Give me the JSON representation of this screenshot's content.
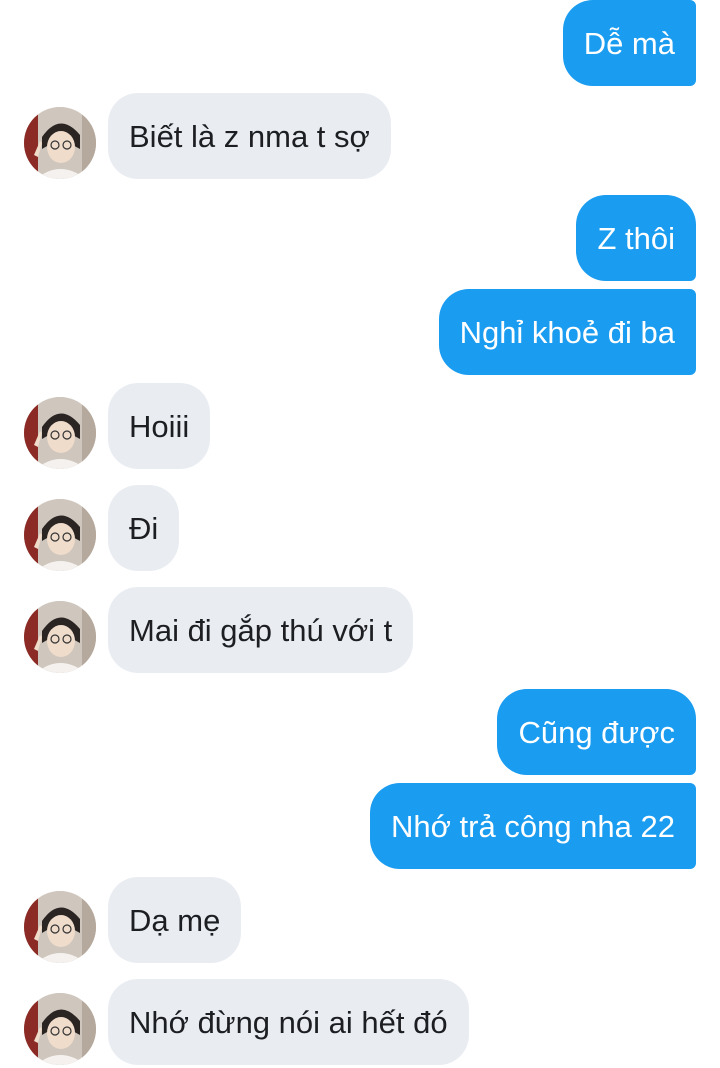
{
  "conversation": {
    "messages": [
      {
        "direction": "sent",
        "text": "Dễ mà"
      },
      {
        "direction": "received",
        "text": "Biết là z nma t sợ"
      },
      {
        "direction": "sent",
        "text": "Z thôi"
      },
      {
        "direction": "sent",
        "text": "Nghỉ khoẻ đi ba"
      },
      {
        "direction": "received",
        "text": "Hoiii"
      },
      {
        "direction": "received",
        "text": "Đi"
      },
      {
        "direction": "received",
        "text": "Mai đi gắp thú với t"
      },
      {
        "direction": "sent",
        "text": "Cũng được"
      },
      {
        "direction": "sent",
        "text": "Nhớ trả công nha 22"
      },
      {
        "direction": "received",
        "text": "Dạ mẹ"
      },
      {
        "direction": "received",
        "text": "Nhớ đừng nói ai hết đó"
      }
    ]
  },
  "colors": {
    "sent_bubble": "#1a9cf0",
    "received_bubble": "#e9edf2",
    "sent_text": "#ffffff",
    "received_text": "#1c1e21"
  },
  "icons": {
    "avatar": "contact-avatar-photo"
  }
}
